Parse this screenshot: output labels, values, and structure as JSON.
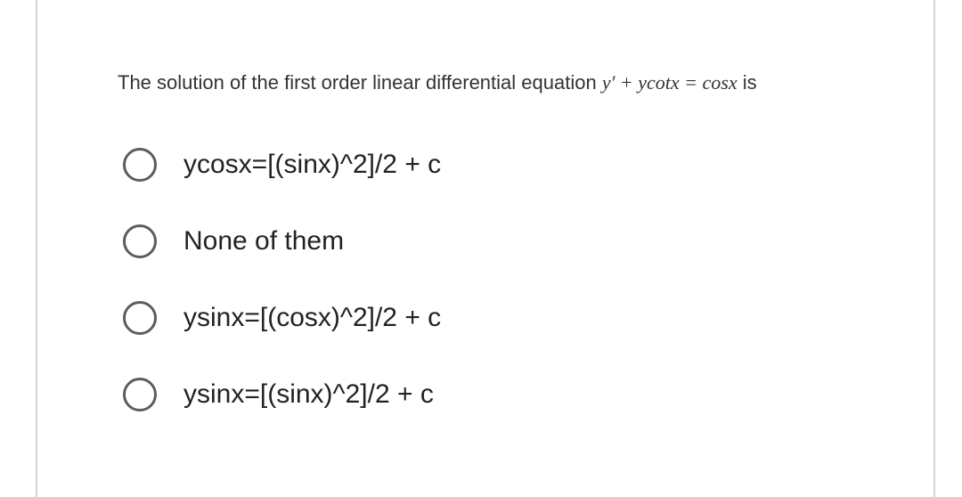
{
  "question": {
    "prefix": "The solution of the first order linear differential equation ",
    "equation": "y′ + ycotx = cosx",
    "suffix": " is"
  },
  "options": [
    {
      "label": "ycosx=[(sinx)^2]/2 + c"
    },
    {
      "label": "None of them"
    },
    {
      "label": "ysinx=[(cosx)^2]/2 + c"
    },
    {
      "label": "ysinx=[(sinx)^2]/2 + c"
    }
  ]
}
